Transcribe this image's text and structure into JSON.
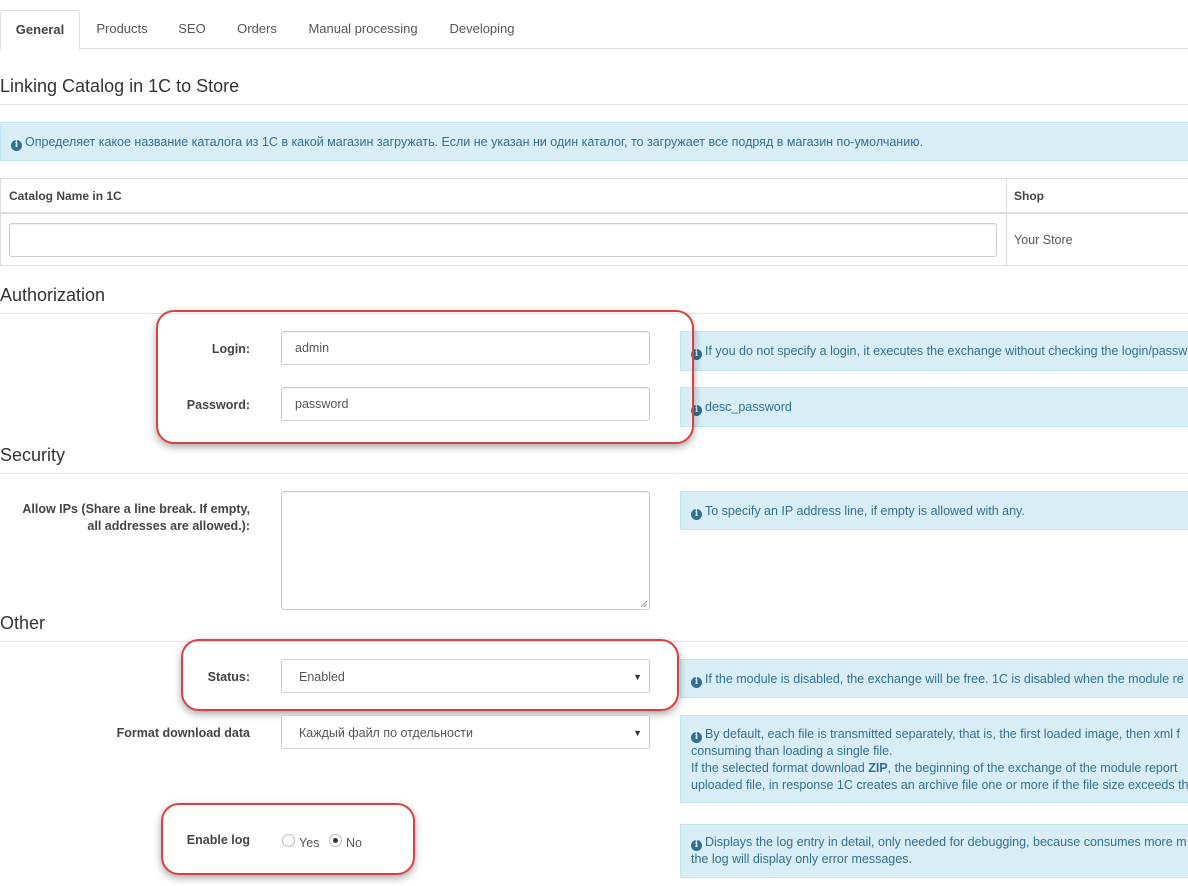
{
  "tabs": [
    {
      "label": "General",
      "active": true
    },
    {
      "label": "Products"
    },
    {
      "label": "SEO"
    },
    {
      "label": "Orders"
    },
    {
      "label": "Manual processing"
    },
    {
      "label": "Developing"
    }
  ],
  "linking": {
    "title": "Linking Catalog in 1C to Store",
    "info": "Определяет какое название каталога из 1С в какой магазин загружать. Если не указан ни один каталог, то загружает все подряд в магазин по-умолчанию.",
    "table": {
      "headers": [
        "Catalog Name in 1C",
        "Shop"
      ],
      "rows": [
        {
          "catalog_name": "",
          "shop": "Your Store"
        }
      ]
    }
  },
  "authorization": {
    "title": "Authorization",
    "login_label": "Login:",
    "login_value": "admin",
    "login_help": "If you do not specify a login, it executes the exchange without checking the login/passw",
    "password_label": "Password:",
    "password_value": "password",
    "password_help": "desc_password"
  },
  "security": {
    "title": "Security",
    "ips_label_line1": "Allow IPs (Share a line break. If empty,",
    "ips_label_line2": "all addresses are allowed.):",
    "ips_value": "",
    "ips_help": "To specify an IP address line, if empty is allowed with any."
  },
  "other": {
    "title": "Other",
    "status_label": "Status:",
    "status_value": "Enabled",
    "status_help": "If the module is disabled, the exchange will be free. 1C is disabled when the module re",
    "format_label": "Format download data",
    "format_value": "Каждый файл по отдельности",
    "format_help_line1": "By default, each file is transmitted separately, that is, the first loaded image, then xml f",
    "format_help_line2": "consuming than loading a single file.",
    "format_help_line3_pre": "If the selected format download ",
    "format_help_line3_bold": "ZIP",
    "format_help_line3_post": ", the beginning of the exchange of the module report",
    "format_help_line4": "uploaded file, in response 1C creates an archive file one or more if the file size exceeds th",
    "log_label": "Enable log",
    "log_options": [
      "Yes",
      "No"
    ],
    "log_selected": "No",
    "log_help_line1": "Displays the log entry in detail, only needed for debugging, because consumes more m",
    "log_help_line2": "the log will display only error messages."
  },
  "colors": {
    "highlight": "#d9423f",
    "info_bg": "#d9edf7",
    "info_text": "#31708f"
  }
}
